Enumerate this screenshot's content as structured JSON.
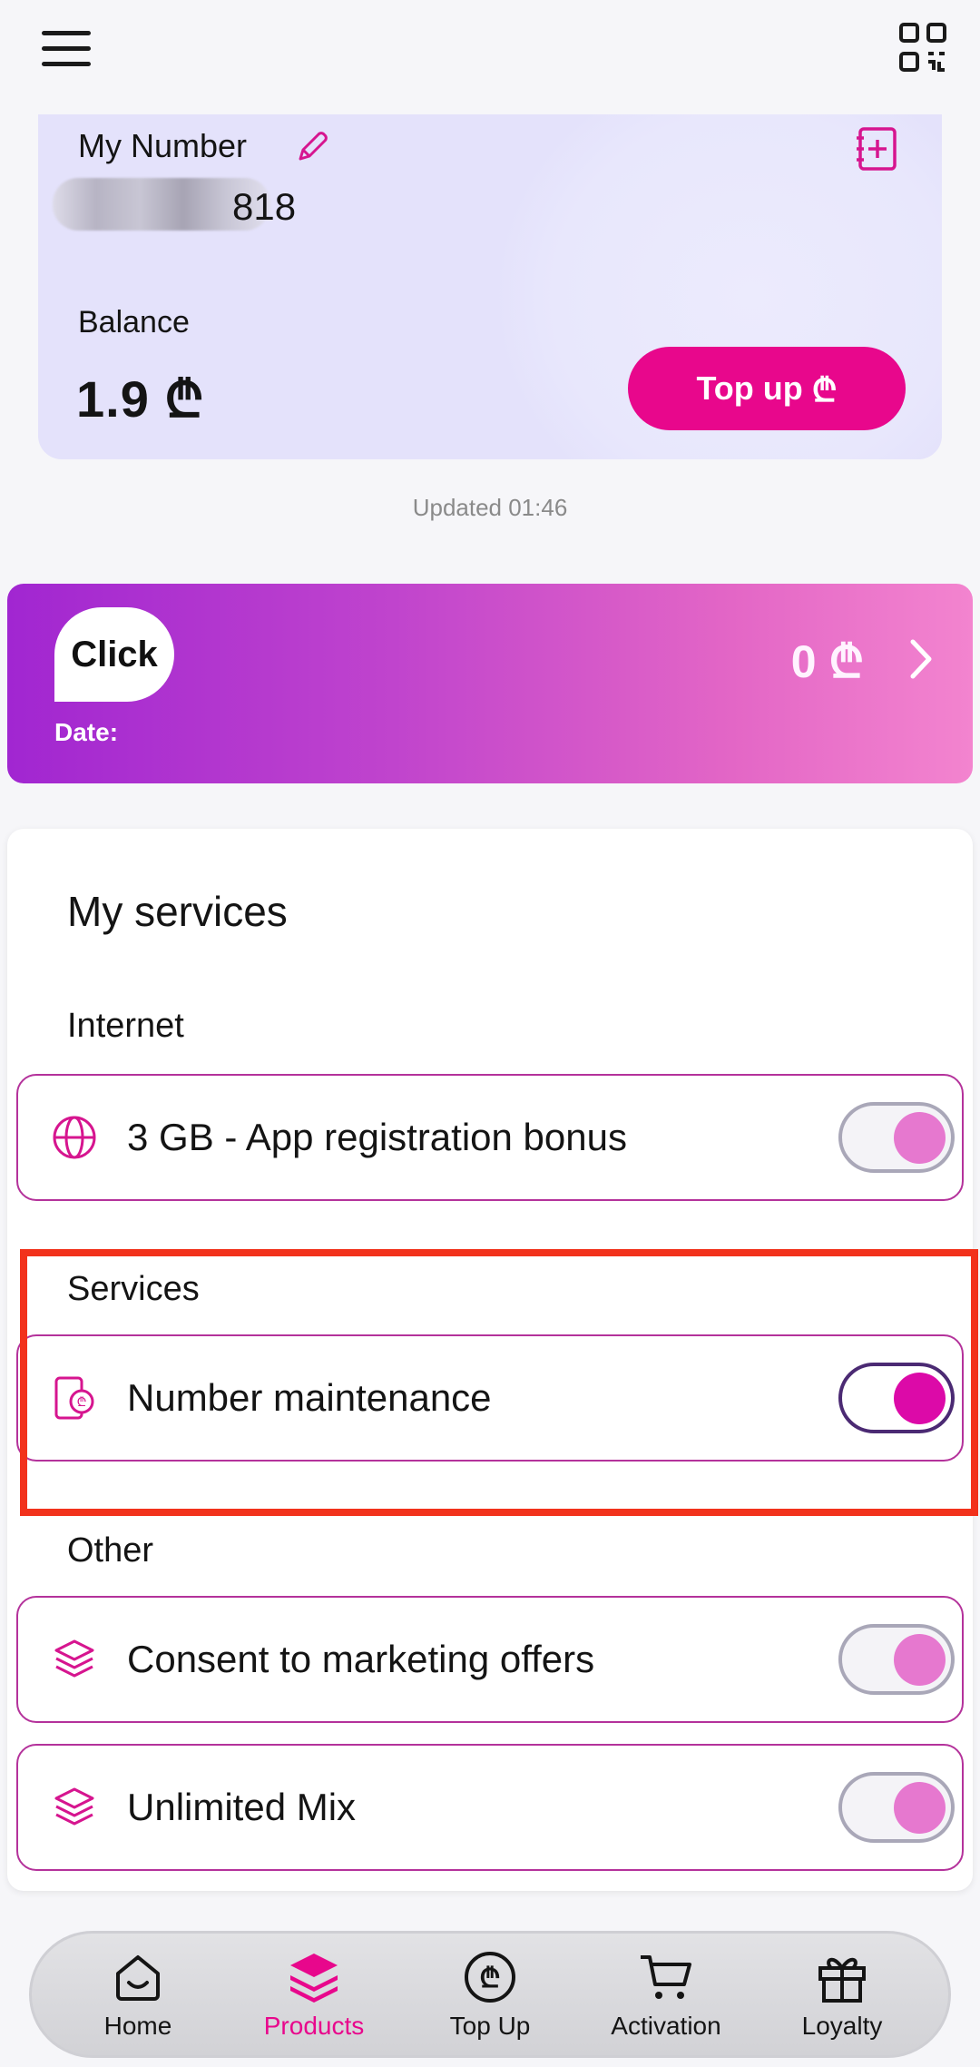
{
  "header": {
    "menu_icon": "hamburger-icon",
    "qr_icon": "qr-code-icon"
  },
  "account": {
    "my_number_label": "My Number",
    "number_suffix": "818",
    "balance_label": "Balance",
    "balance_value": "1.9 ₾",
    "topup_label": "Top up",
    "topup_icon": "lari-icon",
    "updated_text": "Updated 01:46"
  },
  "click": {
    "logo_text": "Click",
    "date_label": "Date:",
    "amount": "0 ₾"
  },
  "services": {
    "title": "My services",
    "sections": [
      {
        "label": "Internet",
        "items": [
          {
            "label": "3 GB - App registration bonus",
            "icon": "globe-icon",
            "enabled": true,
            "emphasized": false
          }
        ]
      },
      {
        "label": "Services",
        "items": [
          {
            "label": "Number maintenance",
            "icon": "phone-lari-icon",
            "enabled": true,
            "emphasized": true
          }
        ]
      },
      {
        "label": "Other",
        "items": [
          {
            "label": "Consent to marketing offers",
            "icon": "layers-icon",
            "enabled": true,
            "emphasized": false
          },
          {
            "label": "Unlimited Mix",
            "icon": "layers-icon",
            "enabled": true,
            "emphasized": false
          }
        ]
      }
    ]
  },
  "nav": {
    "items": [
      {
        "label": "Home",
        "icon": "home-icon",
        "active": false
      },
      {
        "label": "Products",
        "icon": "layers-icon",
        "active": true
      },
      {
        "label": "Top Up",
        "icon": "lari-coin-icon",
        "active": false
      },
      {
        "label": "Activation",
        "icon": "cart-icon",
        "active": false
      },
      {
        "label": "Loyalty",
        "icon": "gift-icon",
        "active": false
      }
    ]
  },
  "colors": {
    "accent": "#e8078c",
    "card_bg": "#e4e2fb",
    "row_border": "#b4329b",
    "highlight": "#f2321c"
  }
}
